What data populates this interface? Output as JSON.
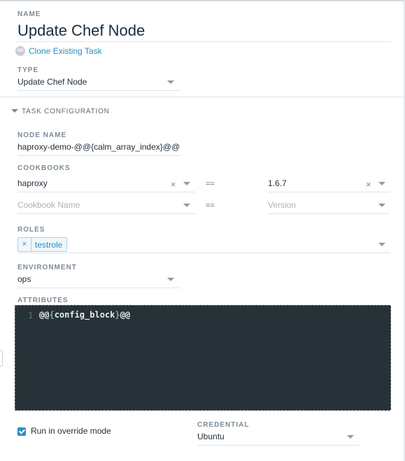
{
  "name": {
    "label": "NAME",
    "value": "Update Chef Node",
    "or_badge": "OR",
    "clone_link": "Clone Existing Task"
  },
  "type": {
    "label": "TYPE",
    "value": "Update Chef Node"
  },
  "section": {
    "title": "TASK CONFIGURATION"
  },
  "node_name": {
    "label": "NODE NAME",
    "value": "haproxy-demo-@@{calm_array_index}@@"
  },
  "cookbooks": {
    "label": "COOKBOOKS",
    "operator": "==",
    "clear_glyph": "×",
    "rows": [
      {
        "name": "haproxy",
        "version": "1.6.7"
      }
    ],
    "new_row": {
      "name_placeholder": "Cookbook Name",
      "version_placeholder": "Version"
    }
  },
  "roles": {
    "label": "ROLES",
    "tags": [
      {
        "remove_glyph": "×",
        "label": "testrole"
      }
    ]
  },
  "environment": {
    "label": "ENVIRONMENT",
    "value": "ops"
  },
  "attributes": {
    "label": "ATTRIBUTES",
    "line_number": "1",
    "code": {
      "open_at": "@@",
      "open_brace": "{",
      "identifier": "config_block",
      "close_brace": "}",
      "close_at": "@@"
    }
  },
  "override": {
    "checked": true,
    "label": "Run in override mode"
  },
  "credential": {
    "label": "CREDENTIAL",
    "value": "Ubuntu"
  },
  "icons": {
    "caret": "chevron-down-icon",
    "clear": "clear-icon",
    "section_toggle": "collapse-triangle-icon",
    "checkbox": "checkmark-icon"
  },
  "colors": {
    "accent": "#2a8fc0",
    "editor_bg": "#263238",
    "label": "#7c8a96",
    "brace": "#7fb27f"
  }
}
